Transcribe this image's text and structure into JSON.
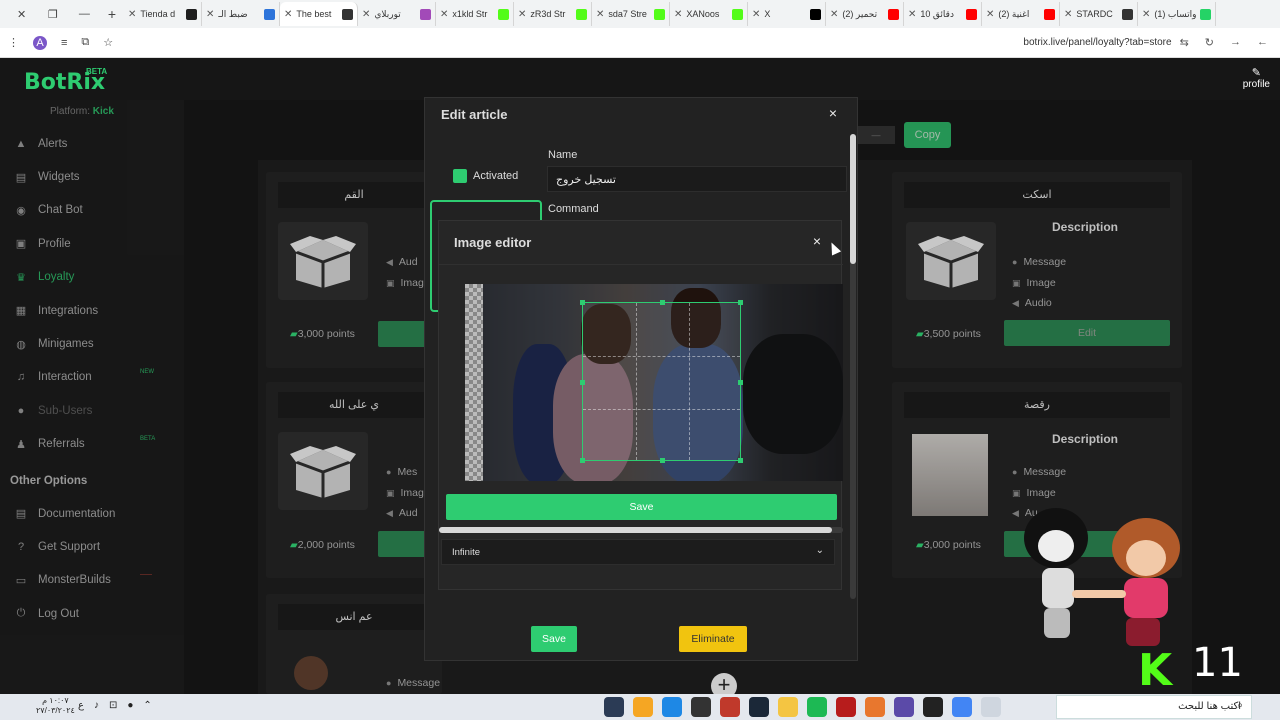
{
  "browser": {
    "tabs": [
      {
        "title": "Tienda d",
        "icon_color": "#1e1e1e",
        "active": false
      },
      {
        "title": "ضبط الـ",
        "icon_color": "#2d74da",
        "active": false
      },
      {
        "title": "The best",
        "icon_color": "#333333",
        "active": true
      },
      {
        "title": "توربلاي",
        "icon_color": "#a24ab8",
        "active": false
      },
      {
        "title": "x1kld Str",
        "icon_color": "#53fc18",
        "active": false
      },
      {
        "title": "zR3d Str",
        "icon_color": "#53fc18",
        "active": false
      },
      {
        "title": "sda7 Stre",
        "icon_color": "#53fc18",
        "active": false
      },
      {
        "title": "XANoos",
        "icon_color": "#53fc18",
        "active": false
      },
      {
        "title": "X",
        "icon_color": "#000000",
        "active": false
      },
      {
        "title": "(2) تحمير",
        "icon_color": "#ff0000",
        "active": false
      },
      {
        "title": "10 دقائق",
        "icon_color": "#ff0000",
        "active": false
      },
      {
        "title": "(2) اغنية",
        "icon_color": "#ff0000",
        "active": false
      },
      {
        "title": "STARDC",
        "icon_color": "#333333",
        "active": false
      },
      {
        "title": "(1) واتساب",
        "icon_color": "#25d366",
        "active": false
      }
    ],
    "avatar_letter": "A",
    "url": "botrix.live/panel/loyalty?tab=store",
    "profile_label": "profile"
  },
  "app": {
    "logo": "BotRix",
    "logo_badge": "BETA",
    "platform_label": "Platform:",
    "platform_value": "Kick"
  },
  "sidebar": {
    "items": [
      {
        "label": "Alerts",
        "icon": "▲",
        "icon_name": "alert-icon",
        "state": ""
      },
      {
        "label": "Widgets",
        "icon": "▤",
        "icon_name": "widgets-icon",
        "state": ""
      },
      {
        "label": "Chat Bot",
        "icon": "◉",
        "icon_name": "chatbot-icon",
        "state": ""
      },
      {
        "label": "Profile",
        "icon": "▣",
        "icon_name": "profile-card-icon",
        "state": ""
      },
      {
        "label": "Loyalty",
        "icon": "♛",
        "icon_name": "loyalty-icon",
        "state": "active"
      },
      {
        "label": "Integrations",
        "icon": "▦",
        "icon_name": "integrations-icon",
        "state": ""
      },
      {
        "label": "Minigames",
        "icon": "◍",
        "icon_name": "minigames-icon",
        "state": ""
      },
      {
        "label": "Interaction",
        "icon": "♫",
        "icon_name": "interaction-icon",
        "state": "",
        "badge": "NEW"
      },
      {
        "label": "Sub-Users",
        "icon": "●",
        "icon_name": "sub-users-icon",
        "state": "dim"
      },
      {
        "label": "Referrals",
        "icon": "♟",
        "icon_name": "referrals-icon",
        "state": "",
        "badge": "BETA"
      }
    ],
    "other_title": "Other Options",
    "other_items": [
      {
        "label": "Documentation",
        "icon": "▤",
        "icon_name": "documentation-icon"
      },
      {
        "label": "Get Support",
        "icon": "?",
        "icon_name": "support-icon"
      },
      {
        "label": "MonsterBuilds",
        "icon": "▭",
        "icon_name": "monitor-icon",
        "badge": "red"
      },
      {
        "label": "Log Out",
        "icon": "⏻",
        "icon_name": "logout-icon"
      }
    ]
  },
  "store": {
    "copy_label": "Copy",
    "cards": [
      {
        "title": "القم",
        "points": "3,000 points",
        "desc_items": [
          "Aud",
          "Imag"
        ]
      },
      {
        "title": "اسكت",
        "points": "3,500 points",
        "desc_title": "Description",
        "desc_items": [
          "Message",
          "Image",
          "Audio"
        ],
        "button": "Edit"
      },
      {
        "title": "ي على الله",
        "points": "2,000 points",
        "desc_items": [
          "Mes",
          "Imag",
          "Aud"
        ]
      },
      {
        "title": "رقصة",
        "points": "3,000 points",
        "desc_title": "Description",
        "desc_items": [
          "Message",
          "Image",
          "Au"
        ]
      },
      {
        "title": "عم انس",
        "desc_items": [
          "Message"
        ]
      }
    ]
  },
  "edit_modal": {
    "title": "Edit article",
    "close": "×",
    "activated_label": "Activated",
    "name_label": "Name",
    "name_value": "تسجيل خروج",
    "command_label": "Command",
    "save_label": "Save",
    "eliminate_label": "Eliminate"
  },
  "image_editor": {
    "title": "Image editor",
    "close": "×",
    "save_label": "Save",
    "duration_value": "Infinite"
  },
  "overlay": {
    "counter": "11",
    "kick_letter": "K"
  },
  "taskbar": {
    "time": "١٠:٠٧ م",
    "date": "٢٧/٠٣/٢٠٢٤",
    "search_placeholder": "اكتب هنا للبحث",
    "lang": "ع"
  },
  "colors": {
    "accent": "#2ecc71",
    "warning": "#f1c40f",
    "kick": "#53fc18"
  }
}
